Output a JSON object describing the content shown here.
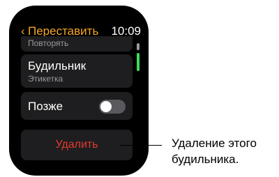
{
  "header": {
    "back_chevron": "‹",
    "back_label": "Переставить",
    "time": "10:09"
  },
  "cells": {
    "repeat_sub": "Повторять",
    "alarm_title": "Будильник",
    "alarm_sub": "Этикетка",
    "snooze_title": "Позже",
    "snooze_on": false
  },
  "delete_button": {
    "label": "Удалить"
  },
  "callout": {
    "line1": "Удаление этого",
    "line2": "будильника."
  },
  "colors": {
    "accent": "#f5a623",
    "destructive": "#e53a2e",
    "scroll_green": "#3ddc5a",
    "cell_bg": "#1e1e20"
  }
}
